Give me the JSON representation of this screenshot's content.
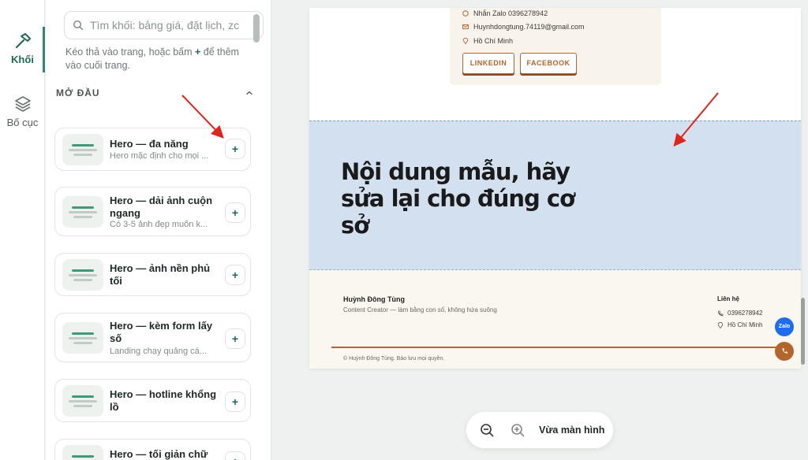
{
  "rail": {
    "blocks_label": "Khối",
    "layout_label": "Bố cục"
  },
  "panel": {
    "search_placeholder": "Tìm khối: bảng giá, đặt lịch, zc",
    "hint_before": "Kéo thả vào trang, hoặc bấm ",
    "hint_plus": "+",
    "hint_after": " để thêm vào cuối trang.",
    "section_title": "MỞ ĐẦU",
    "cards": [
      {
        "title": "Hero — đa năng",
        "desc": "Hero mặc định cho mọi ..."
      },
      {
        "title": "Hero — dải ảnh cuộn ngang",
        "desc": "Có 3-5 ảnh đẹp muốn k..."
      },
      {
        "title": "Hero — ảnh nền phủ tối",
        "desc": ""
      },
      {
        "title": "Hero — kèm form lấy số",
        "desc": "Landing chạy quảng cá..."
      },
      {
        "title": "Hero — hotline khổng lồ",
        "desc": ""
      },
      {
        "title": "Hero — tối giản chữ",
        "desc": ""
      }
    ],
    "add_label": "+"
  },
  "page": {
    "contact": {
      "zalo": "Nhắn Zalo 0396278942",
      "email": "Huynhdongtung.74119@gmail.com",
      "location": "Hồ Chí Minh",
      "linkedin": "LINKEDIN",
      "facebook": "FACEBOOK"
    },
    "hero_title": "Nội dung mẫu, hãy sửa lại cho đúng cơ sở",
    "footer": {
      "name": "Huỳnh Đông Tùng",
      "tagline": "Content Creator — làm bằng con số, không hứa suông",
      "contact_head": "Liên hệ",
      "phone": "0396278942",
      "location": "Hồ Chí Minh",
      "copyright": "© Huỳnh Đông Tùng. Bảo lưu mọi quyền."
    },
    "fab_zalo": "Zalo"
  },
  "zoom": {
    "fit_label": "Vừa màn hình"
  },
  "colors": {
    "accent": "#2e8a6a",
    "brand_brown": "#b5652b",
    "hero_bg": "#d3e0ef",
    "annotation_red": "#e0251c",
    "zalo_blue": "#1e6cf0"
  }
}
